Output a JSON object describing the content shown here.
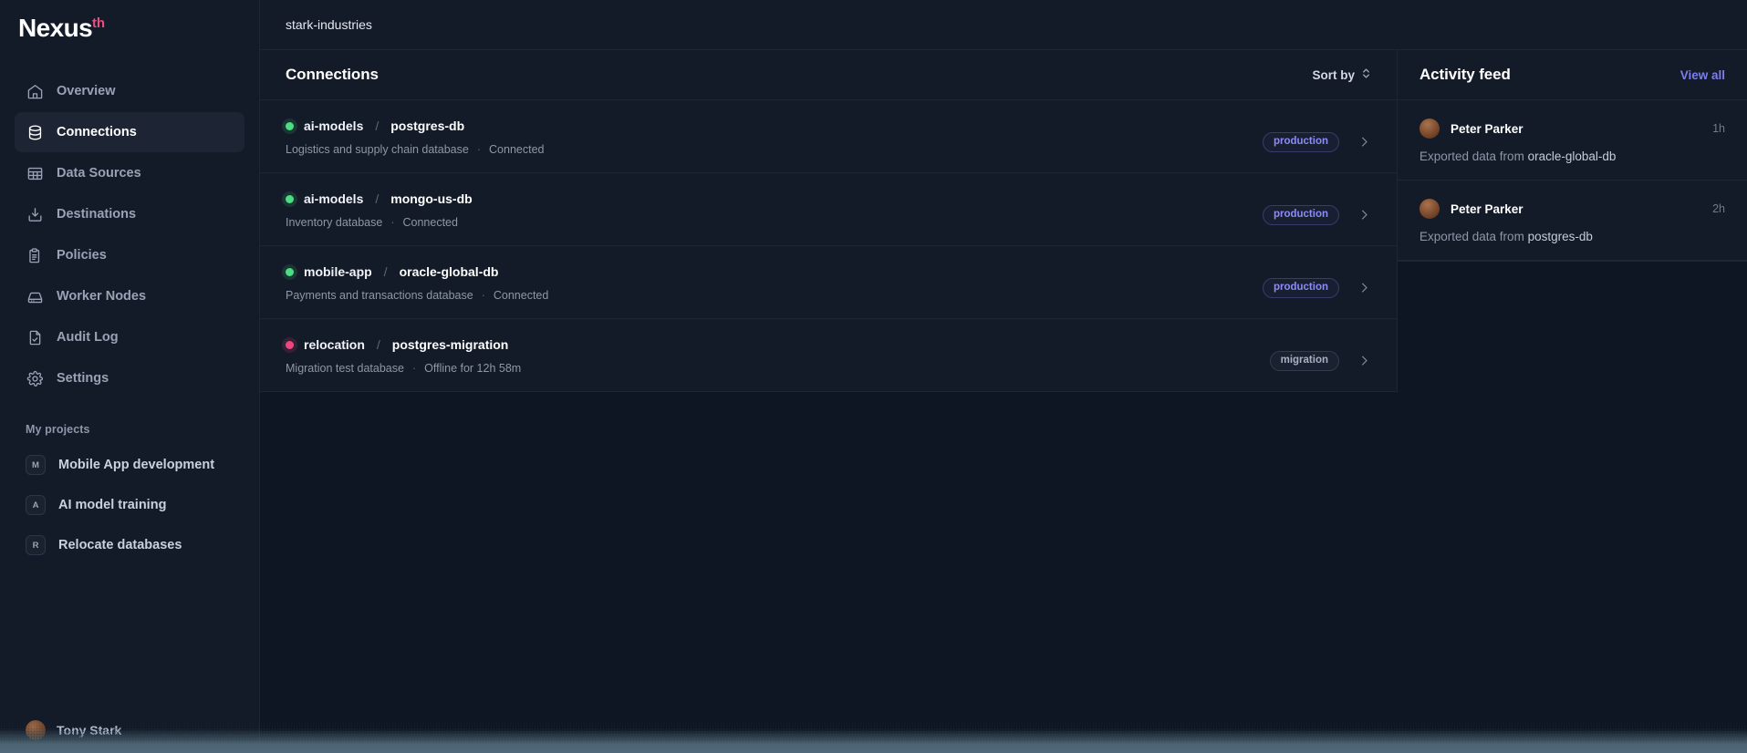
{
  "brand": {
    "name": "Nexus",
    "superscript": "th"
  },
  "sidebar": {
    "nav": [
      {
        "label": "Overview",
        "icon": "home-icon",
        "active": false
      },
      {
        "label": "Connections",
        "icon": "database-icon",
        "active": true
      },
      {
        "label": "Data Sources",
        "icon": "table-icon",
        "active": false
      },
      {
        "label": "Destinations",
        "icon": "download-icon",
        "active": false
      },
      {
        "label": "Policies",
        "icon": "clipboard-icon",
        "active": false
      },
      {
        "label": "Worker Nodes",
        "icon": "server-icon",
        "active": false
      },
      {
        "label": "Audit Log",
        "icon": "document-check-icon",
        "active": false
      },
      {
        "label": "Settings",
        "icon": "gear-icon",
        "active": false
      }
    ],
    "projects_title": "My projects",
    "projects": [
      {
        "initial": "M",
        "label": "Mobile App development"
      },
      {
        "initial": "A",
        "label": "AI model training"
      },
      {
        "initial": "R",
        "label": "Relocate databases"
      }
    ],
    "user": {
      "name": "Tony Stark"
    }
  },
  "topbar": {
    "breadcrumb": "stark-industries"
  },
  "connections_panel": {
    "title": "Connections",
    "sort_label": "Sort by",
    "rows": [
      {
        "namespace": "ai-models",
        "separator": "/",
        "database": "postgres-db",
        "description": "Logistics and supply chain database",
        "status": "Connected",
        "status_color": "green",
        "badge": "production",
        "badge_kind": "production"
      },
      {
        "namespace": "ai-models",
        "separator": "/",
        "database": "mongo-us-db",
        "description": "Inventory database",
        "status": "Connected",
        "status_color": "green",
        "badge": "production",
        "badge_kind": "production"
      },
      {
        "namespace": "mobile-app",
        "separator": "/",
        "database": "oracle-global-db",
        "description": "Payments and transactions database",
        "status": "Connected",
        "status_color": "green",
        "badge": "production",
        "badge_kind": "production"
      },
      {
        "namespace": "relocation",
        "separator": "/",
        "database": "postgres-migration",
        "description": "Migration test database",
        "status": "Offline for 12h 58m",
        "status_color": "pink",
        "badge": "migration",
        "badge_kind": "migration"
      }
    ]
  },
  "activity_feed": {
    "title": "Activity feed",
    "view_all_label": "View all",
    "items": [
      {
        "user": "Peter Parker",
        "time": "1h",
        "action": "Exported data from",
        "target": "oracle-global-db"
      },
      {
        "user": "Peter Parker",
        "time": "2h",
        "action": "Exported data from",
        "target": "postgres-db"
      }
    ]
  },
  "colors": {
    "accent": "#7c7df2",
    "brand_accent": "#ee4d7f",
    "status_online": "#4ade80",
    "status_offline": "#f0467e",
    "panel": "#131a28",
    "page_bg": "#0f1623"
  }
}
